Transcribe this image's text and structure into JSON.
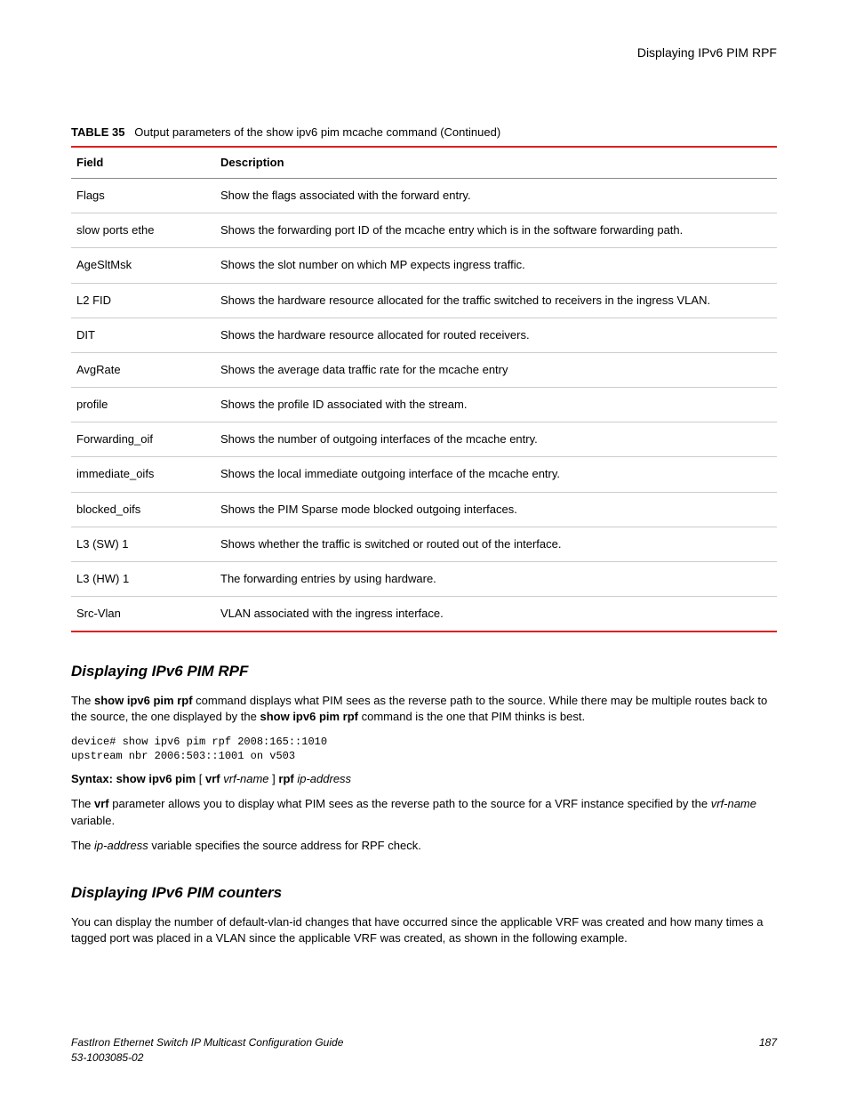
{
  "header": {
    "right": "Displaying IPv6 PIM RPF"
  },
  "table": {
    "captionLabel": "TABLE 35",
    "captionText": "Output parameters of the show ipv6 pim mcache command (Continued)",
    "head": {
      "c1": "Field",
      "c2": "Description"
    },
    "rows": [
      {
        "field": "Flags",
        "desc": "Show the flags associated with the forward entry."
      },
      {
        "field": "slow ports ethe",
        "desc": "Shows the forwarding port ID of the mcache entry which is in the software forwarding path."
      },
      {
        "field": "AgeSltMsk",
        "desc": "Shows the slot number on which MP expects ingress traffic."
      },
      {
        "field": "L2 FID",
        "desc": "Shows the hardware resource allocated for the traffic switched to receivers in the ingress VLAN."
      },
      {
        "field": "DIT",
        "desc": "Shows the hardware resource allocated for routed receivers."
      },
      {
        "field": "AvgRate",
        "desc": "Shows the average data traffic rate for the mcache entry"
      },
      {
        "field": "profile",
        "desc": "Shows the profile ID associated with the stream."
      },
      {
        "field": "Forwarding_oif",
        "desc": "Shows the number of outgoing interfaces of the mcache entry."
      },
      {
        "field": "immediate_oifs",
        "desc": "Shows the local immediate outgoing interface of the mcache entry."
      },
      {
        "field": "blocked_oifs",
        "desc": "Shows the PIM Sparse mode blocked outgoing interfaces."
      },
      {
        "field": "L3 (SW) 1",
        "desc": "Shows whether the traffic is switched or routed out of the interface."
      },
      {
        "field": "L3 (HW) 1",
        "desc": "The forwarding entries by using hardware."
      },
      {
        "field": "Src-Vlan",
        "desc": "VLAN associated with the ingress interface."
      }
    ]
  },
  "section1": {
    "title": "Displaying IPv6 PIM RPF",
    "p1a": "The ",
    "p1b": "show ipv6 pim rpf",
    "p1c": " command displays what PIM sees as the reverse path to the source. While there may be multiple routes back to the source, the one displayed by the ",
    "p1d": "show ipv6 pim rpf",
    "p1e": " command is the one that PIM thinks is best.",
    "code": "device# show ipv6 pim rpf 2008:165::1010\nupstream nbr 2006:503::1001 on v503",
    "syntax_label": "Syntax: show ipv6 pim",
    "syntax_vrf": "vrf",
    "syntax_vrfname": "vrf-name",
    "syntax_rpf": "rpf",
    "syntax_ip": "ip-address",
    "p2a": "The ",
    "p2b": "vrf",
    "p2c": " parameter allows you to display what PIM sees as the reverse path to the source for a VRF instance specified by the ",
    "p2d": "vrf-name",
    "p2e": " variable.",
    "p3a": "The ",
    "p3b": "ip-address",
    "p3c": " variable specifies the source address for RPF check."
  },
  "section2": {
    "title": "Displaying IPv6 PIM counters",
    "p1": "You can display the number of default-vlan-id changes that have occurred since the applicable VRF was created and how many times a tagged port was placed in a VLAN since the applicable VRF was created, as shown in the following example."
  },
  "footer": {
    "left1": "FastIron Ethernet Switch IP Multicast Configuration Guide",
    "left2": "53-1003085-02",
    "right": "187"
  }
}
